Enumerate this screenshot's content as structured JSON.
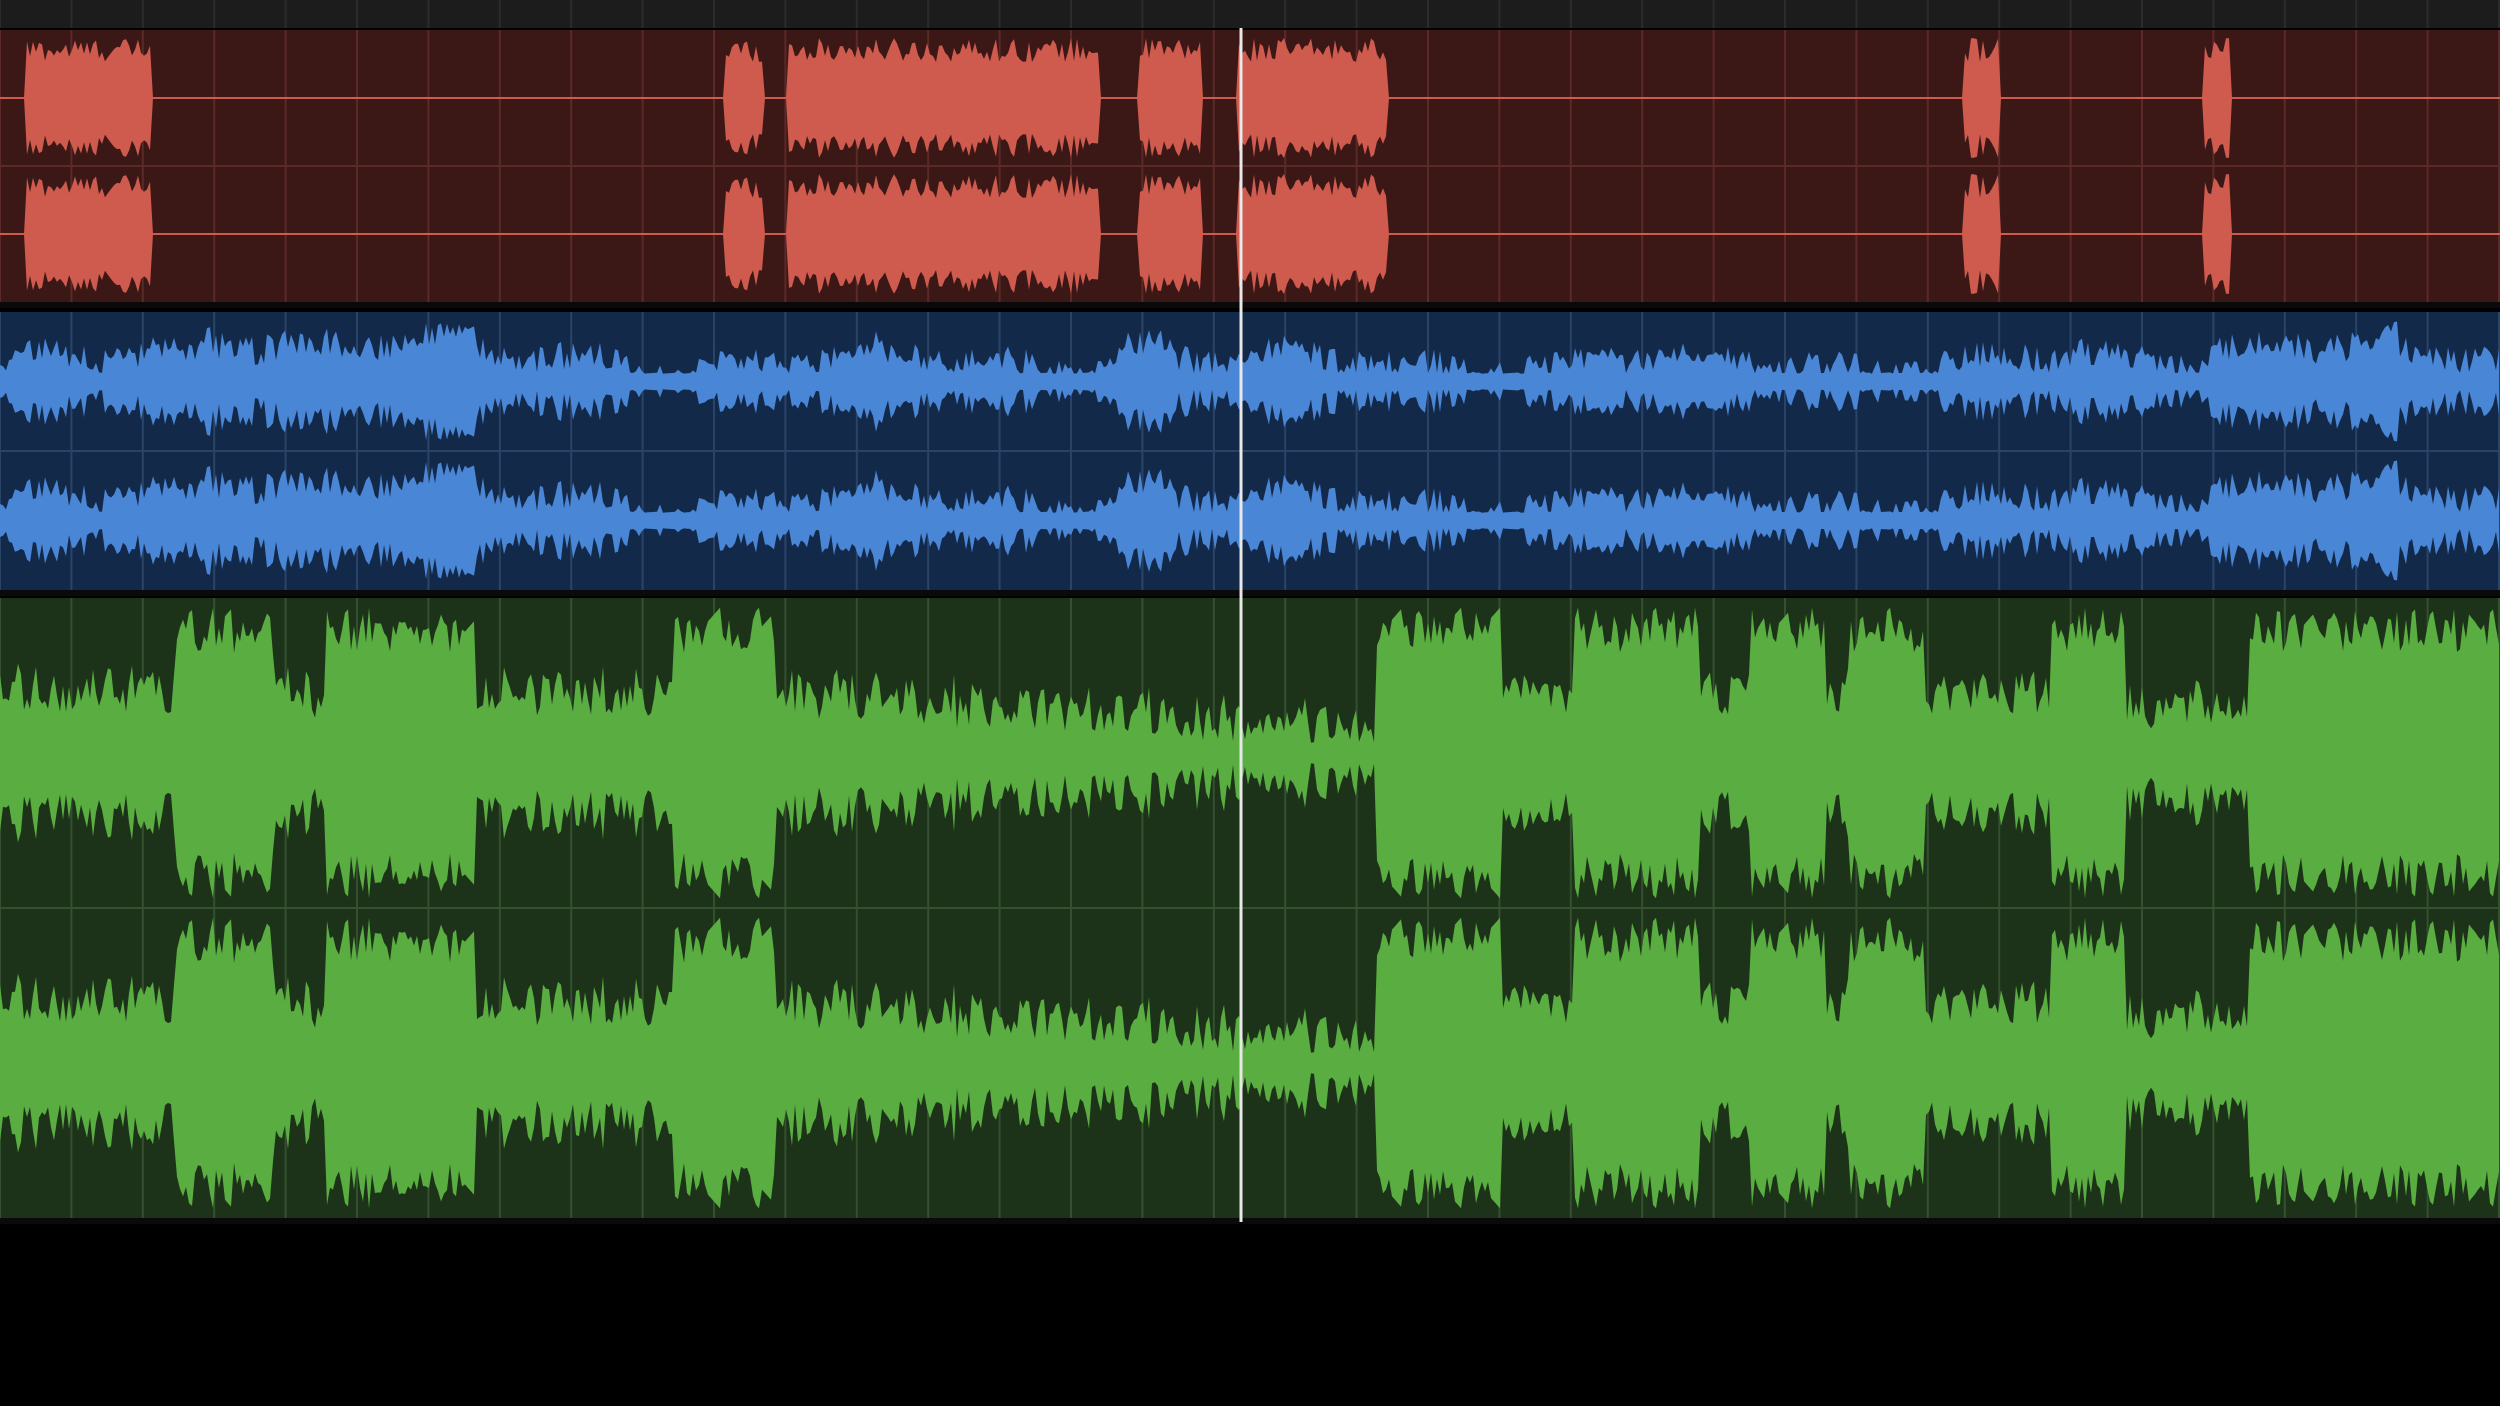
{
  "theme": {
    "background": "#000000",
    "ruler_color": "#1c1c1c",
    "ruler_divider": "#2b2b2b",
    "track_separator": "#0a0a0a",
    "playhead_color": "#e8e8e8"
  },
  "tracks": [
    {
      "id": "track-red",
      "channels": 2,
      "lane_color": "#3b1816",
      "grid_color": "#5a2a27",
      "wave_color": "#cf5a4e",
      "wave_style": "sparse-bursts"
    },
    {
      "id": "track-blue",
      "channels": 2,
      "lane_color": "#13294a",
      "grid_color": "#2a4468",
      "wave_color": "#4a86d6",
      "wave_style": "dense-mid"
    },
    {
      "id": "track-green",
      "channels": 2,
      "lane_color": "#1c3319",
      "grid_color": "#34502f",
      "wave_color": "#5aad40",
      "wave_style": "dense-loud"
    }
  ]
}
